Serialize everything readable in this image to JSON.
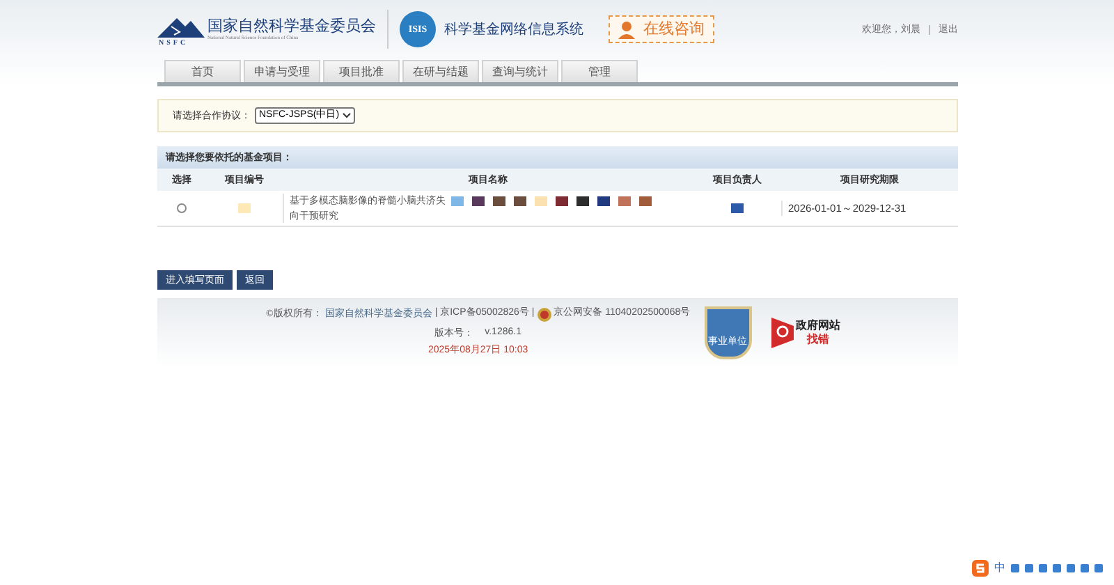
{
  "header": {
    "org_name": "国家自然科学基金委员会",
    "org_name_en": "National Natural Science Foundation of China",
    "logo_text": "NSFC",
    "system_logo_text": "ISIS",
    "system_name": "科学基金网络信息系统",
    "consult_button": "在线咨询",
    "welcome": "欢迎您，刘晨",
    "logout": "退出"
  },
  "nav": [
    {
      "label": "首页",
      "selected": false
    },
    {
      "label": "申请与受理",
      "selected": false
    },
    {
      "label": "项目批准",
      "selected": false
    },
    {
      "label": "在研与结题",
      "selected": false
    },
    {
      "label": "查询与统计",
      "selected": false
    },
    {
      "label": "管理",
      "selected": false
    }
  ],
  "agreement": {
    "label": "请选择合作协议：",
    "value": "NSFC-JSPS(中日)"
  },
  "table": {
    "title": "请选择您要依托的基金项目：",
    "columns": [
      "选择",
      "项目编号",
      "项目名称",
      "项目负责人",
      "项目研究期限"
    ],
    "rows": [
      {
        "selected": false,
        "name_lines": [
          "基于多模态脑影像的脊髓小脑共济失",
          "向干预研究"
        ],
        "period": "2026-01-01～2029-12-31"
      }
    ]
  },
  "buttons": [
    "进入填写页面",
    "返回"
  ],
  "footer": {
    "copyright_label": "©版权所有：",
    "copyright_owner": "国家自然科学基金委员会",
    "icp": "| 京ICP备05002826号 |",
    "police": "京公网安备 11040202500068号",
    "version_label": "版本号：",
    "version": "v.1286.1",
    "datetime": "2025年08月27日 10:03",
    "badge_text": "事业单位",
    "gov_title": "政府网站",
    "gov_sub": "找错"
  },
  "ime": {
    "mode": "中"
  }
}
